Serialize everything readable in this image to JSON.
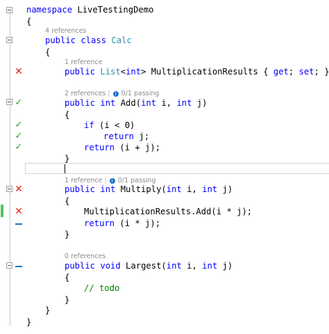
{
  "lens": {
    "calc_refs": "4 references",
    "mult_results_refs": "1 reference",
    "add_refs": "2 references",
    "add_tests": "0/1 passing",
    "multiply_refs": "1 reference",
    "multiply_tests": "0/1 passing",
    "largest_refs": "0 references",
    "separator": "|"
  },
  "code": {
    "l1_kw": "namespace",
    "l1_name": " LiveTestingDemo",
    "l2": "{",
    "l3_kw": "public class",
    "l3_name": "Calc",
    "l4": "{",
    "l5_kw": "public",
    "l5_type": "List",
    "l5_lt": "<",
    "l5_int": "int",
    "l5_rest": "> MultiplicationResults { ",
    "l5_get": "get",
    "l5_mid": "; ",
    "l5_set": "set",
    "l5_end": "; }",
    "l6_kw": "public int",
    "l6_rest1": " Add(",
    "l6_int1": "int",
    "l6_rest2": " i, ",
    "l6_int2": "int",
    "l6_rest3": " j)",
    "l7": "{",
    "l8_kw": "if",
    "l8_rest": " (i < 0)",
    "l9_kw": "return",
    "l9_rest": " j;",
    "l10_kw": "return",
    "l10_rest": " (i + j);",
    "l11": "}",
    "l12_kw": "public int",
    "l12_rest1": " Multiply(",
    "l12_int1": "int",
    "l12_rest2": " i, ",
    "l12_int2": "int",
    "l12_rest3": " j)",
    "l13": "{",
    "l14": "MultiplicationResults.Add(i * j);",
    "l15_kw": "return",
    "l15_rest": " (i * j);",
    "l16": "}",
    "l17_kw": "public void",
    "l17_rest1": " Largest(",
    "l17_int1": "int",
    "l17_rest2": " i, ",
    "l17_int2": "int",
    "l17_rest3": " j)",
    "l18": "{",
    "l19": "// todo",
    "l20": "}",
    "l21": "}",
    "l22": "}"
  },
  "colors": {
    "keyword": "#0000ff",
    "type": "#2b91af",
    "comment": "#008000",
    "pass": "#2e9a2e",
    "fail": "#d9281f",
    "not_covered": "#1e73c8",
    "change_bar": "#57c457"
  },
  "icons": {
    "pass": "check-icon",
    "fail": "cross-icon",
    "not_covered": "dash-icon",
    "collapse": "collapse-minus-icon",
    "info": "info-icon"
  }
}
